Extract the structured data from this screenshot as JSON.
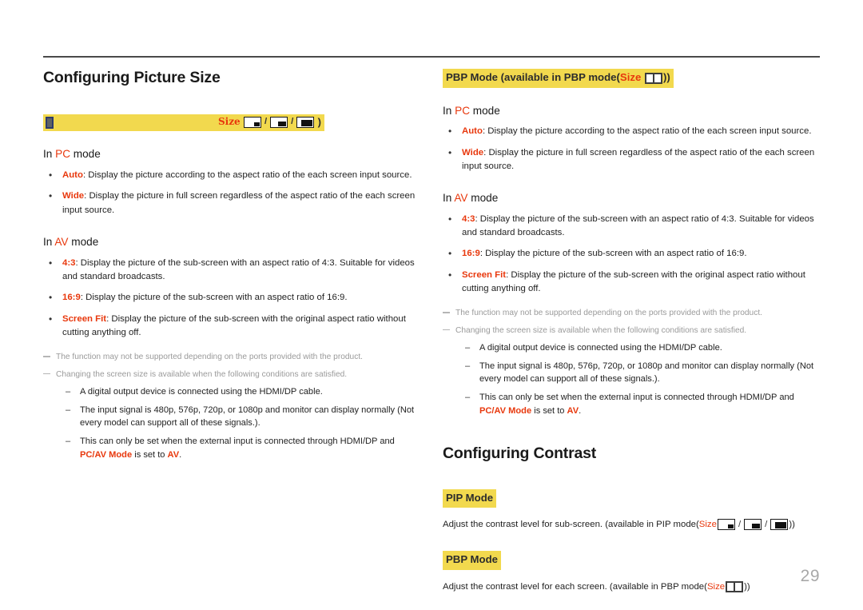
{
  "page": {
    "number": "29",
    "accent_color": "#e8380d",
    "highlight_color": "#f2d94e",
    "rule_color": "#4a4a4a"
  },
  "left": {
    "title": "Configuring Picture Size",
    "banner": {
      "size_label": "Size",
      "close_paren": ")",
      "icons": [
        "pip-small-icon",
        "pip-medium-icon",
        "pip-large-icon"
      ],
      "separator": "/"
    },
    "pc_heading": {
      "pre": "In ",
      "accent": "PC",
      "post": " mode"
    },
    "pc_bullets": [
      {
        "term": "Auto",
        "desc": ": Display the picture according to the aspect ratio of the each screen input source."
      },
      {
        "term": "Wide",
        "desc": ": Display the picture in full screen regardless of the aspect ratio of the each screen input source."
      }
    ],
    "av_heading": {
      "pre": "In ",
      "accent": "AV",
      "post": " mode"
    },
    "av_bullets": [
      {
        "term": "4:3",
        "desc": ": Display the picture of the sub-screen with an aspect ratio of 4:3. Suitable for videos and standard broadcasts."
      },
      {
        "term": "16:9",
        "desc": ": Display the picture of the sub-screen with an aspect ratio of 16:9."
      },
      {
        "term": "Screen Fit",
        "desc": ": Display the picture of the sub-screen with the original aspect ratio without cutting anything off."
      }
    ],
    "notes": [
      "The function may not be supported depending on the ports provided with the product.",
      "Changing the screen size is available when the following conditions are satisfied."
    ],
    "conditions": [
      {
        "text": "A digital output device is connected using the HDMI/DP cable."
      },
      {
        "text": "The input signal is 480p, 576p, 720p, or 1080p and monitor can display normally (Not every model can support all of these signals.)."
      },
      {
        "pre": "This can only be set when the external input is connected through HDMI/DP and ",
        "accent1": "PC/AV Mode",
        "mid": " is set to ",
        "accent2": "AV",
        "post": "."
      }
    ]
  },
  "right": {
    "banner_text_pre": "PBP Mode (available in PBP mode(",
    "banner_size_label": "Size",
    "banner_text_post": "))",
    "pc_heading": {
      "pre": "In ",
      "accent": "PC",
      "post": " mode"
    },
    "pc_bullets": [
      {
        "term": "Auto",
        "desc": ": Display the picture according to the aspect ratio of the each screen input source."
      },
      {
        "term": "Wide",
        "desc": ": Display the picture in full screen regardless of the aspect ratio of the each screen input source."
      }
    ],
    "av_heading": {
      "pre": "In ",
      "accent": "AV",
      "post": " mode"
    },
    "av_bullets": [
      {
        "term": "4:3",
        "desc": ": Display the picture of the sub-screen with an aspect ratio of 4:3. Suitable for videos and standard broadcasts."
      },
      {
        "term": "16:9",
        "desc": ": Display the picture of the sub-screen with an aspect ratio of 16:9."
      },
      {
        "term": "Screen Fit",
        "desc": ": Display the picture of the sub-screen with the original aspect ratio without cutting anything off."
      }
    ],
    "notes": [
      "The function may not be supported depending on the ports provided with the product.",
      "Changing the screen size is available when the following conditions are satisfied."
    ],
    "conditions": [
      {
        "text": "A digital output device is connected using the HDMI/DP cable."
      },
      {
        "text": "The input signal is 480p, 576p, 720p, or 1080p and monitor can display normally (Not every model can support all of these signals.)."
      },
      {
        "pre": "This can only be set when the external input is connected through HDMI/DP and ",
        "accent1": "PC/AV Mode",
        "mid": " is set to ",
        "accent2": "AV",
        "post": "."
      }
    ],
    "contrast": {
      "title": "Configuring Contrast",
      "pip_label": "PIP Mode",
      "pip_text_pre": "Adjust the contrast level for sub-screen. (available in PIP mode(",
      "pip_size_label": "Size",
      "pip_text_post": "))",
      "pbp_label": "PBP Mode",
      "pbp_text_pre": "Adjust the contrast level for each screen. (available in PBP mode(",
      "pbp_size_label": "Size",
      "pbp_text_post": "))",
      "separator": "/"
    }
  }
}
